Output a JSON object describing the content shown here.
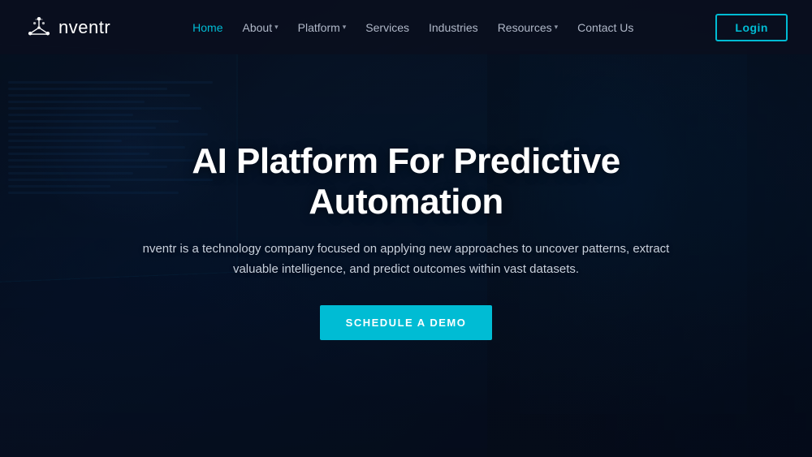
{
  "brand": {
    "name": "nventr",
    "logo_alt": "nventr logo"
  },
  "navbar": {
    "links": [
      {
        "id": "home",
        "label": "Home",
        "active": true,
        "has_dropdown": false
      },
      {
        "id": "about",
        "label": "About",
        "active": false,
        "has_dropdown": true
      },
      {
        "id": "platform",
        "label": "Platform",
        "active": false,
        "has_dropdown": true
      },
      {
        "id": "services",
        "label": "Services",
        "active": false,
        "has_dropdown": false
      },
      {
        "id": "industries",
        "label": "Industries",
        "active": false,
        "has_dropdown": false
      },
      {
        "id": "resources",
        "label": "Resources",
        "active": false,
        "has_dropdown": true
      },
      {
        "id": "contact",
        "label": "Contact Us",
        "active": false,
        "has_dropdown": false
      }
    ],
    "login_label": "Login"
  },
  "hero": {
    "title": "AI Platform For Predictive Automation",
    "subtitle": "nventr is a technology company focused on applying new approaches to uncover patterns, extract valuable intelligence, and predict outcomes within vast datasets.",
    "cta_label": "SCHEDULE A DEMO"
  },
  "colors": {
    "accent": "#00bcd4",
    "nav_bg": "rgba(10,15,30,0.92)",
    "hero_text": "#ffffff",
    "hero_subtitle": "#c8d0dc",
    "active_link": "#00bcd4",
    "inactive_link": "#b0b8c8"
  }
}
